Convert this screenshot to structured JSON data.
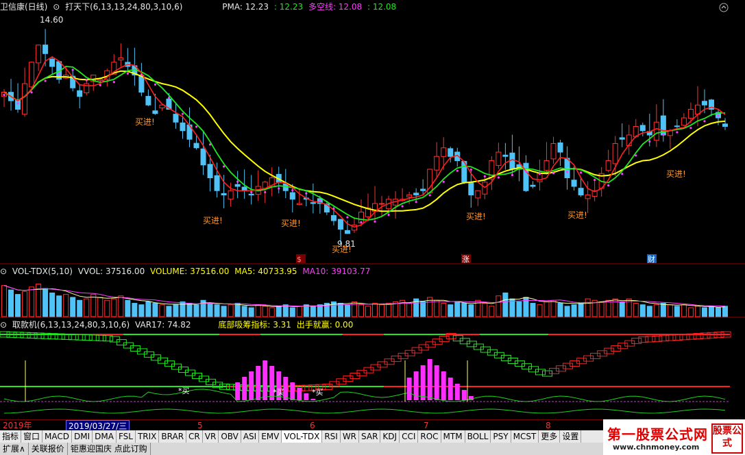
{
  "main": {
    "stock_label": "卫信康(日线)",
    "indicator_label": "打天下(6,13,13,24,80,3,10,6)",
    "pma_label": "PMA: 12.23",
    "green_value": ": 12.23",
    "duokong_label": "多空线: 12.08",
    "green_value2": ": 12.08",
    "high_label": "14.60",
    "low_label": "9.81",
    "buy_label": "买进!",
    "badges": [
      "$",
      "涨",
      "财"
    ]
  },
  "vol": {
    "name": "VOL-TDX(5,10)",
    "vvol": "VVOL: 37516.00",
    "volume": "VOLUME: 37516.00",
    "ma5": "MA5: 40733.95",
    "ma10": "MA10: 39103.77"
  },
  "ind": {
    "name": "取款机(6,13,13,24,80,3,10,6)",
    "var17": "VAR17: 74.82",
    "bottom": "底部吸筹指标: 3.31",
    "out": "出手就赢: 0.00",
    "buy_mark": "买"
  },
  "axis": {
    "year": "2019年",
    "cursor_date": "2019/03/27/三",
    "months": [
      "5",
      "6",
      "7",
      "8"
    ]
  },
  "tabs": [
    "指标",
    "窗口",
    "MACD",
    "DMI",
    "DMA",
    "FSL",
    "TRIX",
    "BRAR",
    "CR",
    "VR",
    "OBV",
    "ASI",
    "EMV",
    "VOL-TDX",
    "RSI",
    "WR",
    "SAR",
    "KDJ",
    "CCI",
    "ROC",
    "MTM",
    "BOLL",
    "PSY",
    "MCST",
    "更多",
    "设置"
  ],
  "status": [
    "扩展∧",
    "关联报价",
    "钜惠迎国庆 点此订购"
  ],
  "logo": {
    "title": "第一股票公式网",
    "url": "www.chnmoney.com",
    "seal": "股票公式"
  },
  "colors": {
    "up": "#ff3030",
    "down": "#4fc3f7",
    "ma_yellow": "#ffff00",
    "ma_green": "#21e821",
    "pma_red": "#ff2020",
    "dot": "#ff3cff"
  },
  "chart_data": [
    {
      "type": "candlestick",
      "title": "卫信康(日线)",
      "annotations": [
        "14.60",
        "9.81",
        "买进!"
      ],
      "x_labels": [
        "2019年",
        "5",
        "6",
        "7",
        "8"
      ],
      "close": [
        13.2,
        13.0,
        12.8,
        13.4,
        13.9,
        14.3,
        14.1,
        13.8,
        13.5,
        13.6,
        13.3,
        13.1,
        13.4,
        13.6,
        13.5,
        13.7,
        13.9,
        14.0,
        13.8,
        13.6,
        13.2,
        12.9,
        12.7,
        12.9,
        12.8,
        12.5,
        12.3,
        12.1,
        11.9,
        11.5,
        11.2,
        10.9,
        10.8,
        10.9,
        11.0,
        10.9,
        10.8,
        11.0,
        11.1,
        11.2,
        11.1,
        10.9,
        10.7,
        10.6,
        10.7,
        10.6,
        10.6,
        10.4,
        10.2,
        10.0,
        9.9,
        10.1,
        10.4,
        10.5,
        10.6,
        10.6,
        10.7,
        10.7,
        10.7,
        10.8,
        10.8,
        10.9,
        11.4,
        11.7,
        11.9,
        11.7,
        11.6,
        11.1,
        10.8,
        10.9,
        11.1,
        11.6,
        11.8,
        11.7,
        11.4,
        11.4,
        10.9,
        11.0,
        11.3,
        11.6,
        12.0,
        11.8,
        11.2,
        11.0,
        10.8,
        10.8,
        10.9,
        11.3,
        11.6,
        12.0,
        12.1,
        12.2,
        12.4,
        12.3,
        12.2,
        12.5,
        12.2,
        12.3,
        12.4,
        12.6,
        12.8,
        12.9,
        12.9,
        12.8,
        12.6,
        12.4
      ]
    },
    {
      "type": "bar",
      "title": "VOL-TDX(5,10)",
      "series": [
        {
          "name": "VOLUME",
          "last": 37516.0
        },
        {
          "name": "MA5",
          "last": 40733.95
        },
        {
          "name": "MA10",
          "last": 39103.77
        }
      ],
      "values": [
        42,
        36,
        30,
        34,
        40,
        44,
        38,
        32,
        28,
        30,
        26,
        22,
        24,
        30,
        26,
        22,
        24,
        28,
        22,
        18,
        16,
        20,
        18,
        16,
        14,
        16,
        20,
        18,
        16,
        22,
        18,
        16,
        14,
        16,
        18,
        14,
        12,
        16,
        14,
        12,
        14,
        16,
        12,
        14,
        16,
        14,
        16,
        18,
        20,
        18,
        16,
        20,
        16,
        14,
        18,
        16,
        18,
        20,
        22,
        18,
        24,
        20,
        26,
        22,
        18,
        16,
        20,
        18,
        16,
        22,
        18,
        14,
        28,
        32,
        24,
        20,
        26,
        18,
        16,
        20,
        22,
        18,
        14,
        16,
        18,
        24,
        22,
        20,
        22,
        24,
        20,
        24,
        18,
        16,
        14,
        16,
        18,
        16,
        14,
        16,
        12,
        14,
        12,
        14,
        12,
        14
      ]
    },
    {
      "type": "line",
      "title": "取款机(6,13,13,24,80,3,10,6)",
      "series": [
        {
          "name": "VAR17",
          "last": 74.82
        },
        {
          "name": "底部吸筹指标",
          "last": 3.31
        },
        {
          "name": "出手就赢",
          "last": 0.0
        }
      ]
    }
  ]
}
